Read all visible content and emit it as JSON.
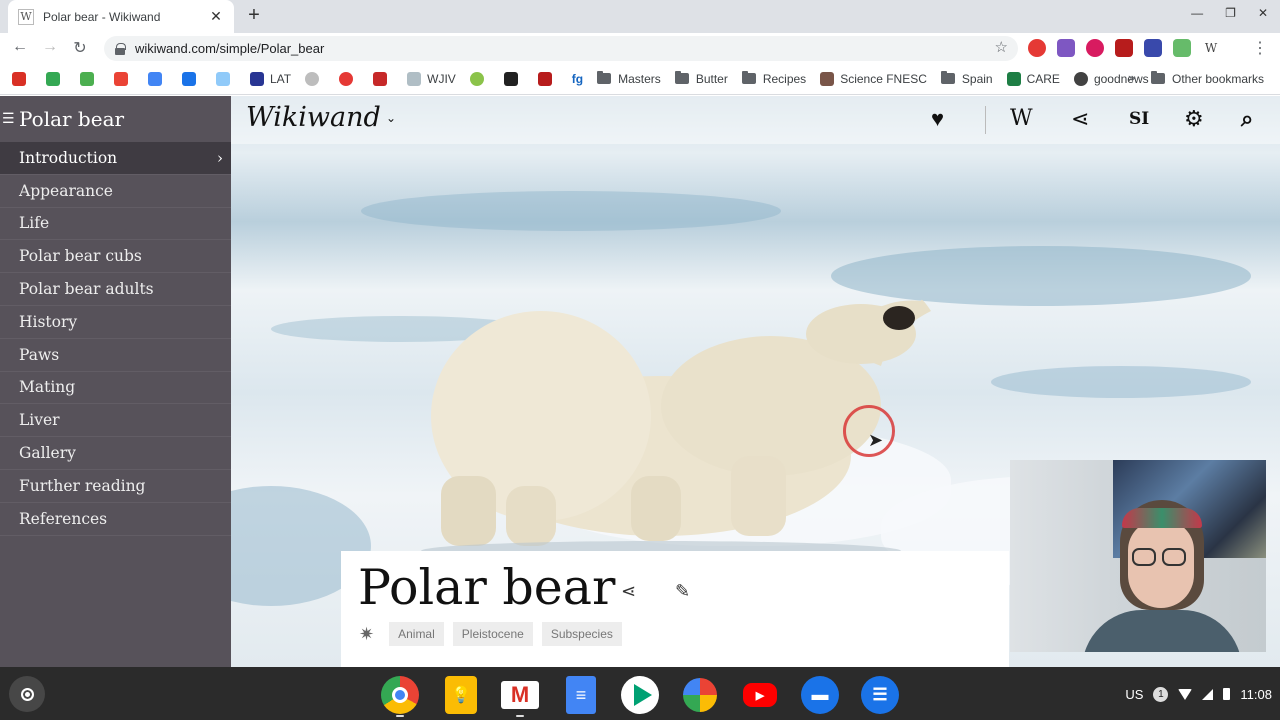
{
  "browser": {
    "tab_title": "Polar bear - Wikiwand",
    "tab_favicon": "W",
    "url": "wikiwand.com/simple/Polar_bear",
    "bookmarks": [
      {
        "label": "",
        "color": "#d93025"
      },
      {
        "label": "",
        "color": "#34a853"
      },
      {
        "label": "",
        "color": "#4caf50"
      },
      {
        "label": "",
        "color": "#ea4335"
      },
      {
        "label": "",
        "color": "#4285f4"
      },
      {
        "label": "",
        "color": "#1a73e8"
      },
      {
        "label": "",
        "color": "#3f51b5"
      },
      {
        "label": "LAT",
        "color": "#283593"
      },
      {
        "label": "",
        "color": "#9e9e9e"
      },
      {
        "label": "",
        "color": "#e53935"
      },
      {
        "label": "",
        "color": "#c62828"
      },
      {
        "label": "WJIV",
        "color": "#90a4ae"
      },
      {
        "label": "",
        "color": "#8bc34a"
      },
      {
        "label": "",
        "color": "#212121"
      },
      {
        "label": "",
        "color": "#b71c1c"
      },
      {
        "label": "fg",
        "color": "#1565c0"
      }
    ],
    "bookmark_folders": [
      "Masters",
      "Butter",
      "Recipes"
    ],
    "bookmark_science": "Science FNESC",
    "bookmark_folder_spain": "Spain",
    "bookmark_care": "CARE",
    "bookmark_goodnews": "goodnews",
    "other_bookmarks": "Other bookmarks"
  },
  "sidebar": {
    "title": "Polar bear",
    "items": [
      {
        "label": "Introduction"
      },
      {
        "label": "Appearance"
      },
      {
        "label": "Life"
      },
      {
        "label": "Polar bear cubs"
      },
      {
        "label": "Polar bear adults"
      },
      {
        "label": "History"
      },
      {
        "label": "Paws"
      },
      {
        "label": "Mating"
      },
      {
        "label": "Liver"
      },
      {
        "label": "Gallery"
      },
      {
        "label": "Further reading"
      },
      {
        "label": "References"
      }
    ]
  },
  "topbar": {
    "logo": "Wikiwand",
    "wiki_letter": "W",
    "language_code": "SI"
  },
  "article": {
    "title": "Polar bear",
    "tags": [
      "Animal",
      "Pleistocene",
      "Subspecies"
    ]
  },
  "shelf": {
    "keyboard_layout": "US",
    "notification_count": "1",
    "time": "11:08"
  }
}
